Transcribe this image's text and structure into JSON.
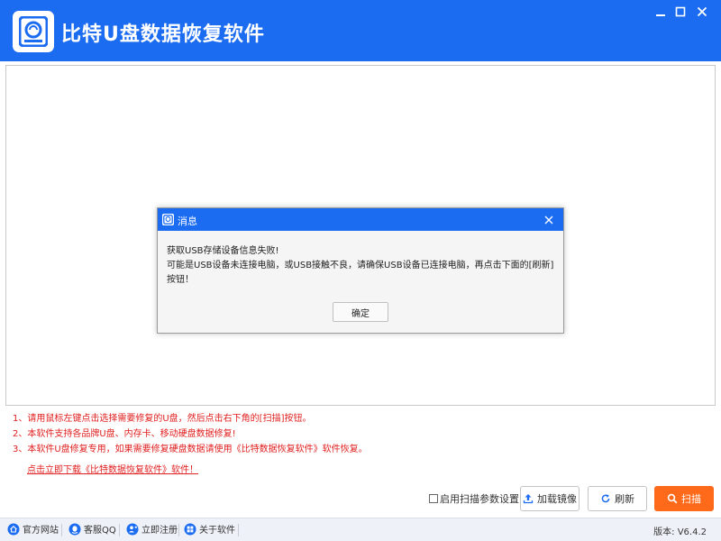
{
  "app": {
    "title": "比特U盘数据恢复软件",
    "logo_icon": "usb-drive-icon",
    "window_controls": [
      "minimize-icon",
      "maximize-icon",
      "close-icon"
    ]
  },
  "notes": [
    "1、请用鼠标左键点击选择需要修复的U盘，然后点击右下角的[扫描]按钮。",
    "2、本软件支持各品牌U盘、内存卡、移动硬盘数据修复!",
    "3、本软件U盘修复专用，如果需要修复硬盘数据请使用《比特数据恢复软件》软件恢复。"
  ],
  "download_link": "点击立即下载《比特数据恢复软件》软件！",
  "actions": {
    "param_toggle_label": "启用扫描参数设置",
    "param_toggle_checked": false,
    "load_image_label": "加载镜像",
    "refresh_label": "刷新",
    "scan_label": "扫描"
  },
  "statusbar": {
    "links": [
      {
        "label": "官方网站",
        "icon": "home-icon"
      },
      {
        "label": "客服QQ",
        "icon": "qq-icon"
      },
      {
        "label": "立即注册",
        "icon": "user-add-icon"
      },
      {
        "label": "关于软件",
        "icon": "info-icon"
      }
    ],
    "version": "版本: V6.4.2"
  },
  "dialog": {
    "title": "消息",
    "line1": "获取USB存储设备信息失败!",
    "line2": "可能是USB设备未连接电脑，或USB接触不良，请确保USB设备已连接电脑，再点击下面的[刷新]按钮！",
    "ok_label": "确定"
  },
  "colors": {
    "brand_blue": "#1c6cf2",
    "note_red": "#e02020",
    "scan_orange": "#ff6a1a"
  }
}
